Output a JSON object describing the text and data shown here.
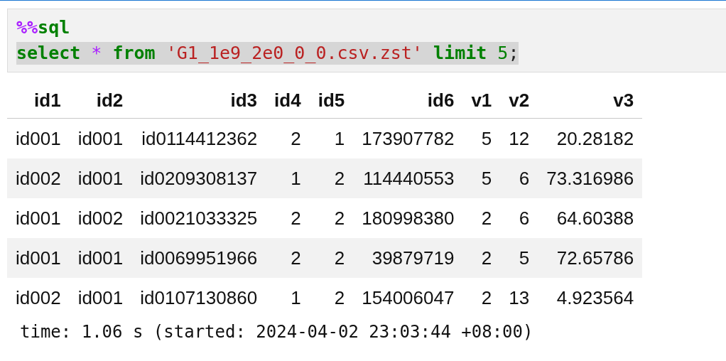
{
  "code_cell": {
    "lines": [
      {
        "highlighted": false,
        "tokens": [
          {
            "kind": "magic",
            "text": "%%"
          },
          {
            "kind": "keyword",
            "text": "sql"
          }
        ]
      },
      {
        "highlighted": true,
        "tokens": [
          {
            "kind": "keyword",
            "text": "select "
          },
          {
            "kind": "operator",
            "text": "* "
          },
          {
            "kind": "keyword",
            "text": "from "
          },
          {
            "kind": "string",
            "text": "'G1_1e9_2e0_0_0.csv.zst' "
          },
          {
            "kind": "keyword",
            "text": "limit "
          },
          {
            "kind": "number",
            "text": "5"
          },
          {
            "kind": "plain",
            "text": ";"
          }
        ]
      }
    ]
  },
  "table": {
    "columns": [
      "id1",
      "id2",
      "id3",
      "id4",
      "id5",
      "id6",
      "v1",
      "v2",
      "v3"
    ],
    "rows": [
      [
        "id001",
        "id001",
        "id0114412362",
        "2",
        "1",
        "173907782",
        "5",
        "12",
        "20.28182"
      ],
      [
        "id002",
        "id001",
        "id0209308137",
        "1",
        "2",
        "114440553",
        "5",
        "6",
        "73.316986"
      ],
      [
        "id001",
        "id002",
        "id0021033325",
        "2",
        "2",
        "180998380",
        "2",
        "6",
        "64.60388"
      ],
      [
        "id001",
        "id001",
        "id0069951966",
        "2",
        "2",
        "39879719",
        "2",
        "5",
        "72.65786"
      ],
      [
        "id002",
        "id001",
        "id0107130860",
        "1",
        "2",
        "154006047",
        "2",
        "13",
        "4.923564"
      ]
    ]
  },
  "timing": "time: 1.06 s (started: 2024-04-02 23:03:44 +08:00)"
}
